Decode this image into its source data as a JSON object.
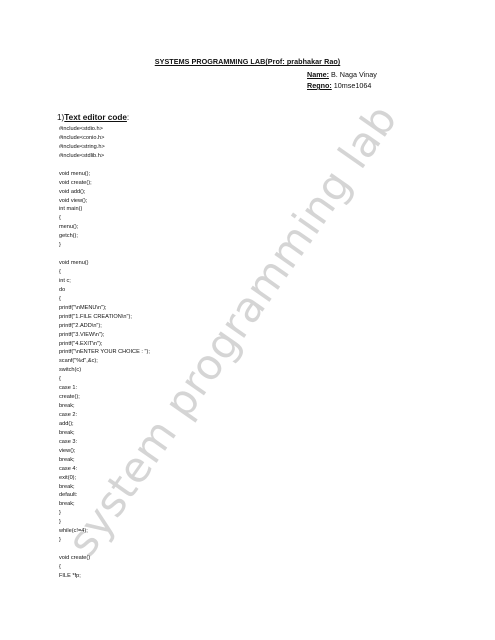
{
  "document": {
    "title": "SYSTEMS PROGRAMMING LAB(Prof: prabhakar Rao)",
    "name_label": "Name:",
    "name_value": "B. Naga Vinay",
    "regno_label": "Regno:",
    "regno_value": "10mse1064",
    "section_number": "1)",
    "section_title": "Text editor code",
    "section_colon": ":",
    "watermark": "system programming lab",
    "code_lines": [
      "#include<stdio.h>",
      "#include<conio.h>",
      "#include<string.h>",
      "#include<stdlib.h>",
      "",
      "void menu();",
      "void create();",
      "void add();",
      "void view();",
      "int main()",
      "{",
      "menu();",
      "getch();",
      "}",
      "",
      "void menu()",
      "{",
      "int c;",
      "do",
      "{",
      "printf(\"\\nMENU\\n\");",
      "printf(\"1.FILE CREATION\\n\");",
      "printf(\"2.ADD\\n\");",
      "printf(\"3.VIEW\\n\");",
      "printf(\"4.EXIT\\n\");",
      "printf(\"\\nENTER YOUR CHOICE : \");",
      "scanf(\"%d\",&c);",
      "switch(c)",
      "{",
      "case 1:",
      "create();",
      "break;",
      "case 2:",
      "add();",
      "break;",
      "case 3:",
      "view();",
      "break;",
      "case 4:",
      "exit(0);",
      "break;",
      "default:",
      "break;",
      "}",
      "}",
      "while(c!=4);",
      "}",
      "",
      "void create()",
      "{",
      "FILE *fp;"
    ]
  }
}
